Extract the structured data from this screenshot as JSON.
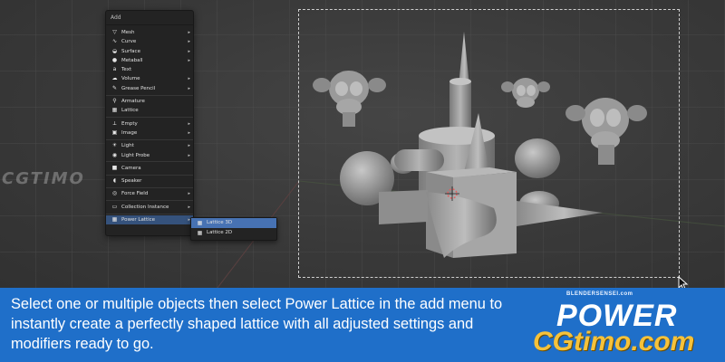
{
  "add_menu": {
    "title": "Add",
    "items": [
      {
        "label": "Mesh",
        "icon": "mesh-icon",
        "has_submenu": true
      },
      {
        "label": "Curve",
        "icon": "curve-icon",
        "has_submenu": true
      },
      {
        "label": "Surface",
        "icon": "surface-icon",
        "has_submenu": true
      },
      {
        "label": "Metaball",
        "icon": "metaball-icon",
        "has_submenu": true
      },
      {
        "label": "Text",
        "icon": "text-icon",
        "has_submenu": false
      },
      {
        "label": "Volume",
        "icon": "volume-icon",
        "has_submenu": true
      },
      {
        "label": "Grease Pencil",
        "icon": "grease-pencil-icon",
        "has_submenu": true
      },
      {
        "label": "Armature",
        "icon": "armature-icon",
        "has_submenu": false
      },
      {
        "label": "Lattice",
        "icon": "lattice-icon",
        "has_submenu": false
      },
      {
        "label": "Empty",
        "icon": "empty-icon",
        "has_submenu": true
      },
      {
        "label": "Image",
        "icon": "image-icon",
        "has_submenu": true
      },
      {
        "label": "Light",
        "icon": "light-icon",
        "has_submenu": true
      },
      {
        "label": "Light Probe",
        "icon": "light-probe-icon",
        "has_submenu": true
      },
      {
        "label": "Camera",
        "icon": "camera-icon",
        "has_submenu": false
      },
      {
        "label": "Speaker",
        "icon": "speaker-icon",
        "has_submenu": false
      },
      {
        "label": "Force Field",
        "icon": "force-field-icon",
        "has_submenu": true
      },
      {
        "label": "Collection Instance",
        "icon": "collection-icon",
        "has_submenu": true
      },
      {
        "label": "Power Lattice",
        "icon": "power-lattice-icon",
        "has_submenu": true
      }
    ]
  },
  "power_lattice_submenu": {
    "items": [
      {
        "label": "Lattice 3D"
      },
      {
        "label": "Lattice 2D"
      }
    ]
  },
  "caption": {
    "text": "Select one or multiple objects then select Power Lattice in the add menu to instantly create a perfectly shaped lattice with all adjusted settings and modifiers ready to go."
  },
  "branding": {
    "small": "BLENDERSENSEI.com",
    "title": "POWER",
    "watermark_right": "CGtimo.com",
    "watermark_left": "CGTIMO"
  },
  "colors": {
    "caption_bg": "#1f6fc9",
    "menu_bg": "#232323",
    "menu_active": "#35527c",
    "submenu_highlight": "#4772b3",
    "watermark_yellow": "#f6c23a"
  }
}
